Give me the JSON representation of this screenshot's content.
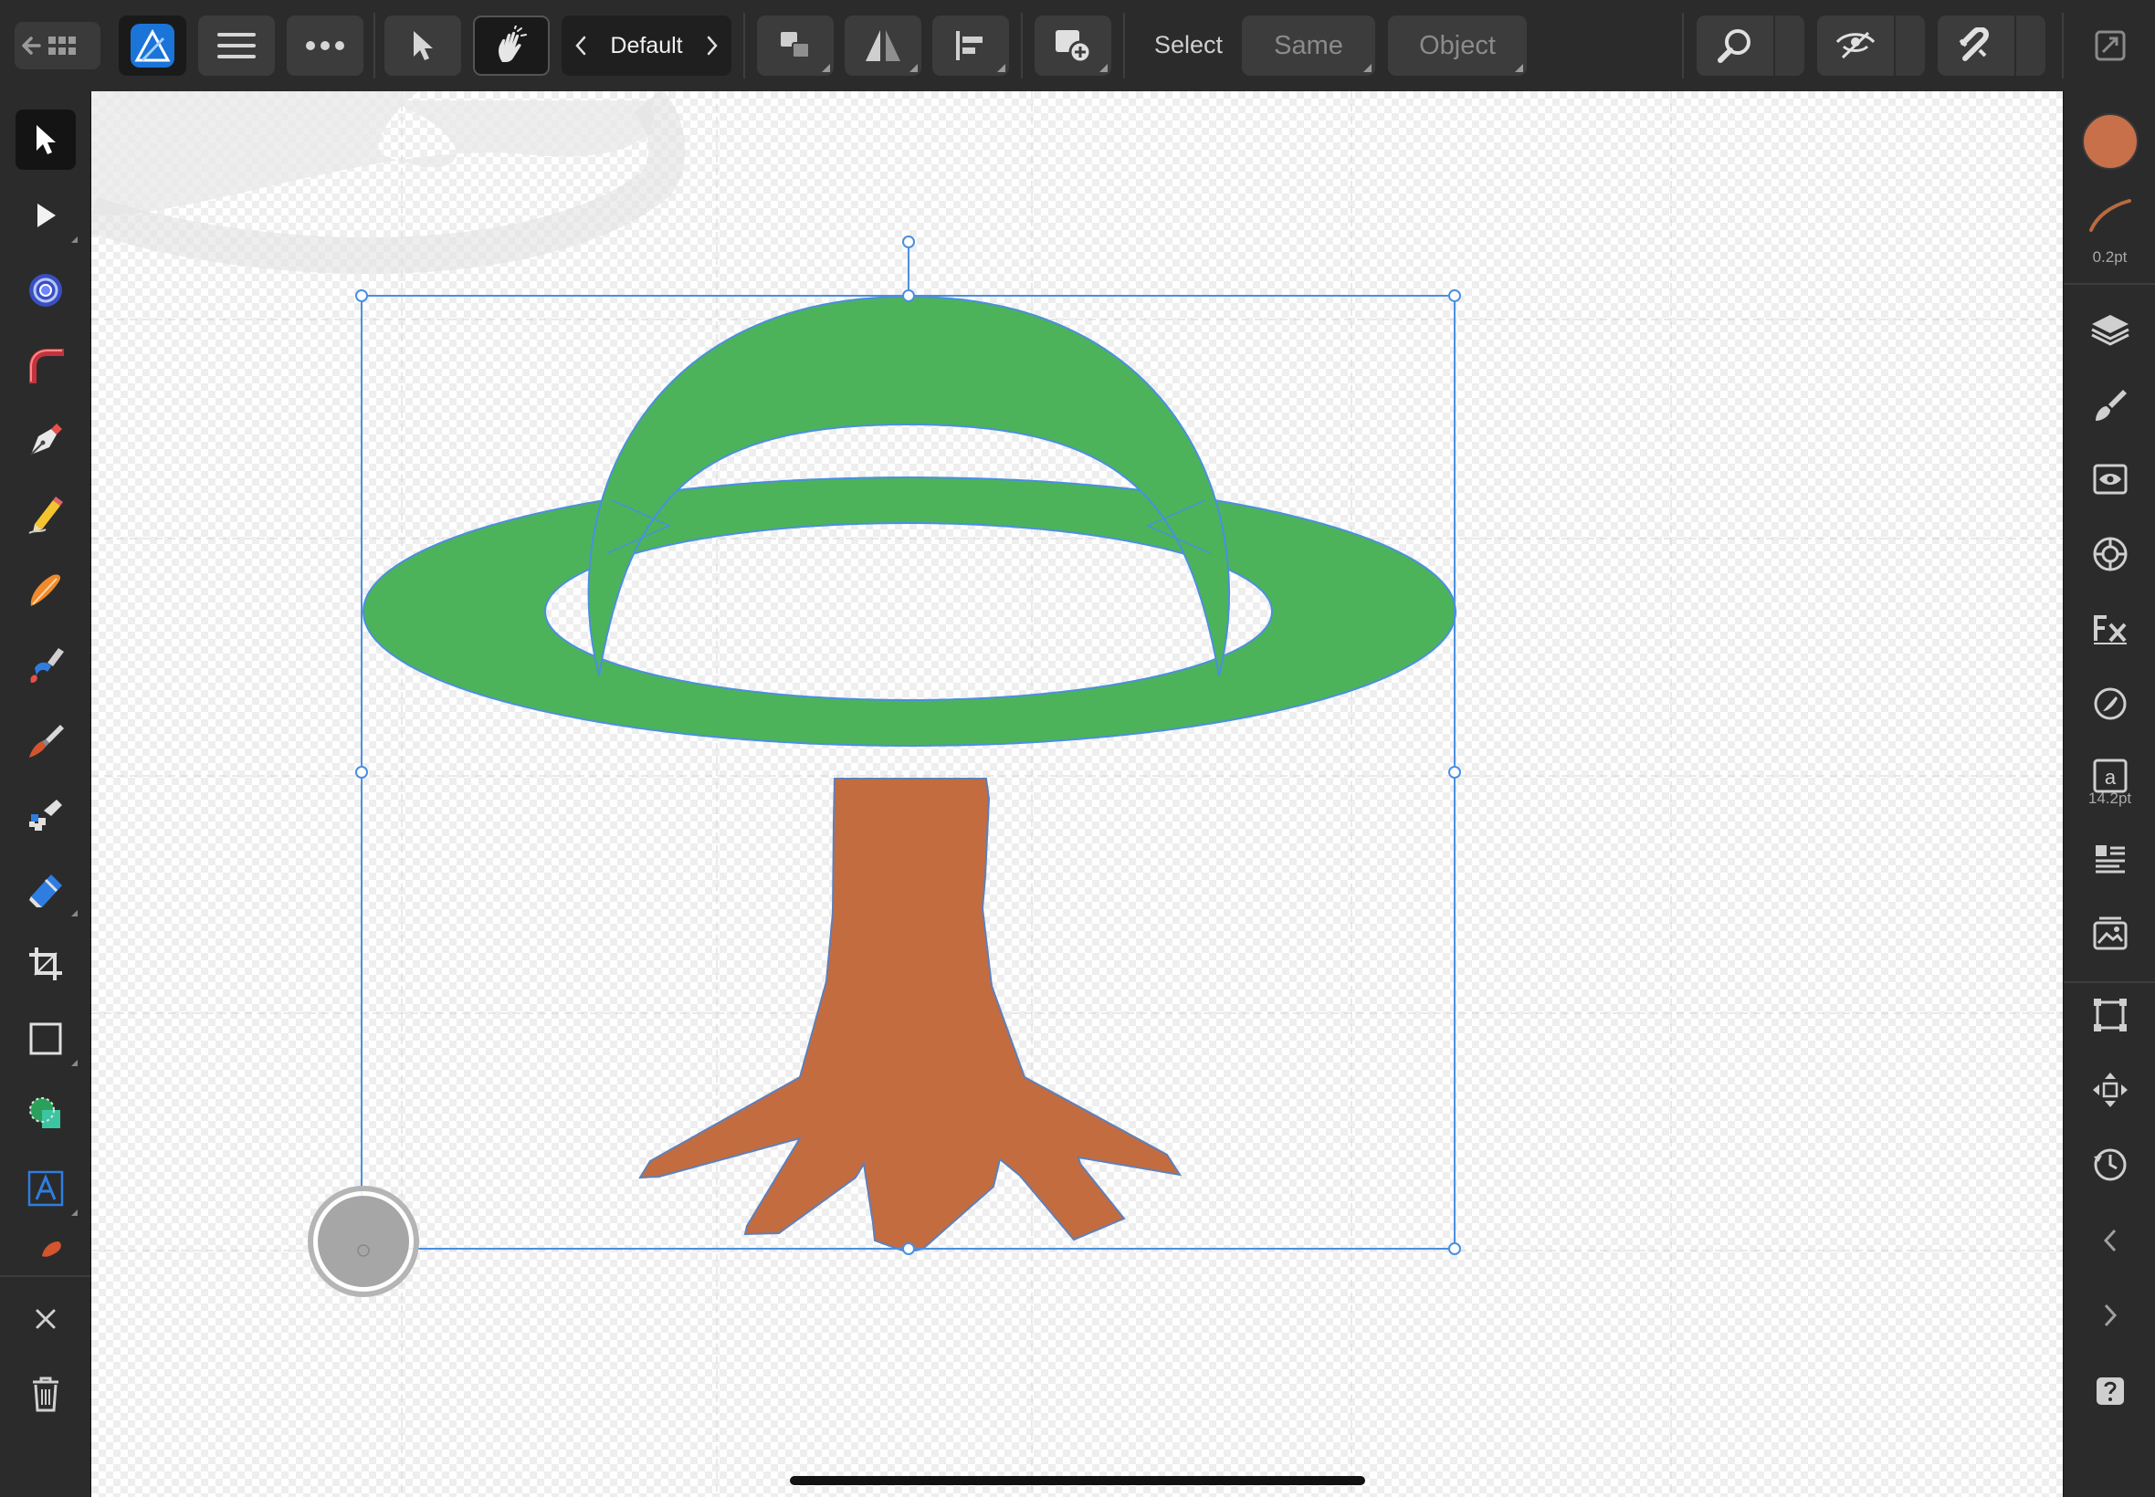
{
  "app": {
    "name": "Affinity Designer"
  },
  "toolbar": {
    "persona_label": "Default",
    "select_label": "Select",
    "same_label": "Same",
    "object_label": "Object"
  },
  "studio": {
    "fill_color": "#c8704a",
    "stroke_color": "#b86a40",
    "stroke_width_label": "0.2pt",
    "text_size_label": "14.2pt"
  },
  "drawing": {
    "ring_color": "#4cb35a",
    "trunk_color": "#c36c40",
    "selection_color": "#4a8fe0"
  },
  "icons": {
    "left_tools": [
      "move-tool-icon",
      "node-tool-icon",
      "contour-tool-icon",
      "corner-tool-icon",
      "pen-tool-icon",
      "pencil-tool-icon",
      "vector-brush-icon",
      "fill-tool-icon",
      "paint-brush-icon",
      "pixel-brush-icon",
      "eraser-icon",
      "crop-icon",
      "rectangle-tool-icon",
      "shape-builder-icon",
      "artistic-text-icon",
      "color-picker-icon"
    ],
    "right_studio": [
      "layers-icon",
      "brushes-icon",
      "appearance-icon",
      "color-icon",
      "fx-icon",
      "stroke-icon",
      "character-icon",
      "paragraph-icon",
      "assets-icon",
      "transform-icon",
      "navigator-icon",
      "history-icon"
    ]
  }
}
